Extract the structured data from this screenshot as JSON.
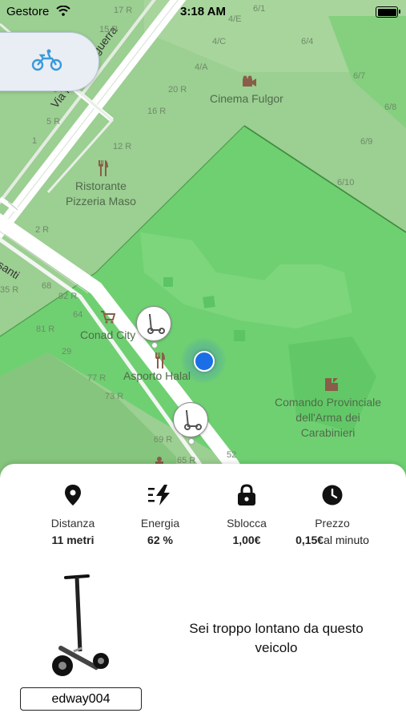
{
  "status_bar": {
    "carrier": "Gestore",
    "time": "3:18 AM",
    "battery_level": 1.0
  },
  "map": {
    "streets": {
      "finiguerra": "Via Maso Finiguerra",
      "ognissanti": "Ognissanti"
    },
    "house_numbers": [
      "17 R",
      "15 R",
      "6/1",
      "4/E",
      "6/4",
      "4/C",
      "4/A",
      "6/7",
      "20 R",
      "6/8",
      "3 R",
      "5 R",
      "16 R",
      "1",
      "12 R",
      "6/9",
      "6/10",
      "2 R",
      "68",
      "92 R",
      "35 R",
      "64",
      "81 R",
      "29",
      "77 R",
      "73 R",
      "69 R",
      "65 R",
      "52"
    ],
    "pois": {
      "cinema": "Cinema Fulgor",
      "ristorante": "Ristorante\nPizzeria Maso",
      "conad": "Conad City",
      "asporto": "Asporto Halal",
      "comando": "Comando Provinciale\ndell'Arma dei\nCarabinieri"
    },
    "poi_icons": [
      "camera-icon",
      "fork-knife-icon",
      "shopping-cart-icon",
      "fork-knife-icon",
      "police-icon",
      "monument-icon"
    ],
    "vehicle_markers": [
      "scooter-marker",
      "scooter-marker"
    ],
    "mode_button_icon": "motorbike-icon"
  },
  "vehicle_sheet": {
    "stats": [
      {
        "icon": "location-pin-icon",
        "label": "Distanza",
        "value": "11 metri",
        "suffix": ""
      },
      {
        "icon": "energy-bolt-icon",
        "label": "Energia",
        "value": "62 %",
        "suffix": ""
      },
      {
        "icon": "padlock-icon",
        "label": "Sblocca",
        "value": "1,00€",
        "suffix": ""
      },
      {
        "icon": "clock-icon",
        "label": "Prezzo",
        "value": "0,15€",
        "suffix": "al minuto"
      }
    ],
    "vehicle_id": "edway004",
    "message": "Sei troppo lontano da questo veicolo",
    "colors": {
      "map_park": "#6fd072",
      "map_base": "#9ccf92",
      "user_dot": "#1a6fe6",
      "mode_icon": "#3a9ad9"
    }
  }
}
